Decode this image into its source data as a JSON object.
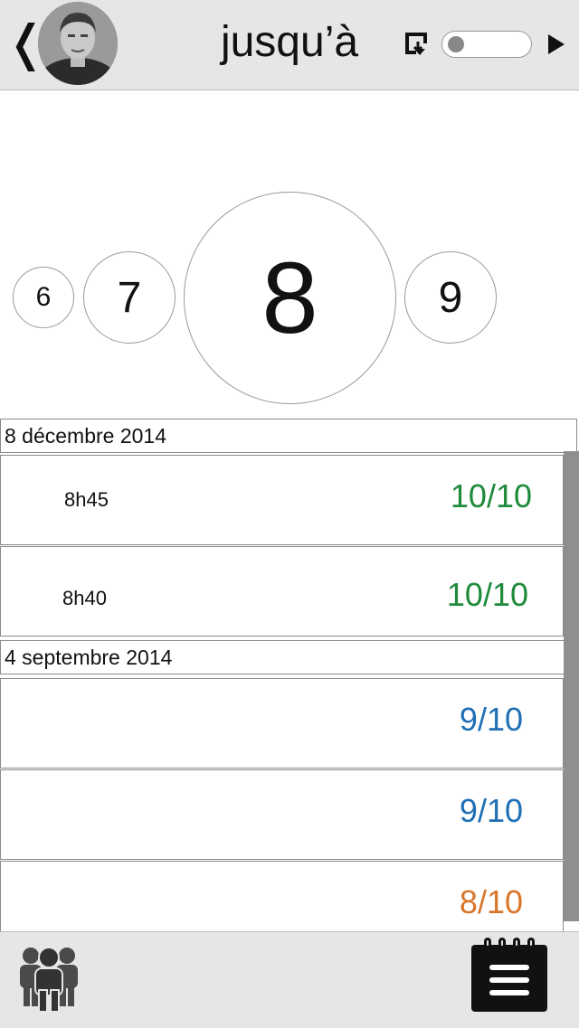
{
  "header": {
    "back_symbol": "❬",
    "title": "jusqu’à",
    "toggle_on": false
  },
  "selector": {
    "values": [
      "6",
      "7",
      "8",
      "9"
    ],
    "selected": "8"
  },
  "sections": [
    {
      "date": "8 décembre 2014",
      "entries": [
        {
          "time": "8h45",
          "score": "10/10",
          "color": "#1e8a3a"
        },
        {
          "time": "8h40",
          "score": "10/10",
          "color": "#1e8a3a"
        }
      ]
    },
    {
      "date": "4 septembre 2014",
      "entries": [
        {
          "time": "",
          "score": "9/10",
          "color": "#1f6fb5"
        },
        {
          "time": "",
          "score": "9/10",
          "color": "#1f6fb5"
        },
        {
          "time": "",
          "score": "8/10",
          "color": "#d9762a"
        }
      ]
    }
  ],
  "footer": {
    "left_icon": "people-icon",
    "right_icon": "notepad-menu-icon"
  }
}
